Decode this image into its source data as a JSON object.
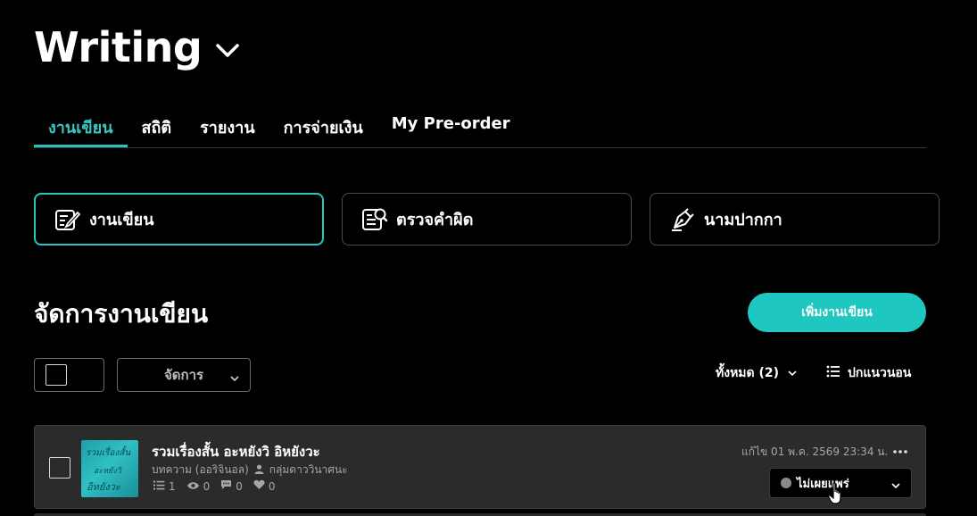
{
  "header": {
    "title": "Writing"
  },
  "tabs": [
    {
      "label": "งานเขียน",
      "active": true
    },
    {
      "label": "สถิติ",
      "active": false
    },
    {
      "label": "รายงาน",
      "active": false
    },
    {
      "label": "การจ่ายเงิน",
      "active": false
    },
    {
      "label": "My Pre-order",
      "active": false
    }
  ],
  "cards": [
    {
      "label": "งานเขียน",
      "icon": "writing-icon",
      "active": true
    },
    {
      "label": "ตรวจคำผิด",
      "icon": "proofread-icon",
      "active": false
    },
    {
      "label": "นามปากกา",
      "icon": "pen-nib-icon",
      "active": false
    }
  ],
  "section": {
    "title": "จัดการงานเขียน",
    "add_button": "เพิ่มงานเขียน"
  },
  "toolbar": {
    "manage_label": "จัดการ",
    "filter_label": "ทั้งหมด (2)",
    "view_label": "ปกแนวนอน"
  },
  "items": [
    {
      "title": "รวมเรื่องสั้น อะหยังวิ อิหยังวะ",
      "type": "บทความ (ออริจินอล)",
      "group": "กลุ่มดาววินาศนะ",
      "chapters": "1",
      "views": "0",
      "comments": "0",
      "likes": "0",
      "edited": "แก้ไข 01 พ.ค. 2569 23:34 น.",
      "status": "ไม่เผยแพร่",
      "cover_text": [
        "รวมเรื่องสั้น",
        "อะหยังวิ",
        "อิหยังวะ"
      ]
    }
  ],
  "colors": {
    "accent": "#1ec7bf",
    "background": "#000000",
    "card": "#2b2b2b"
  }
}
